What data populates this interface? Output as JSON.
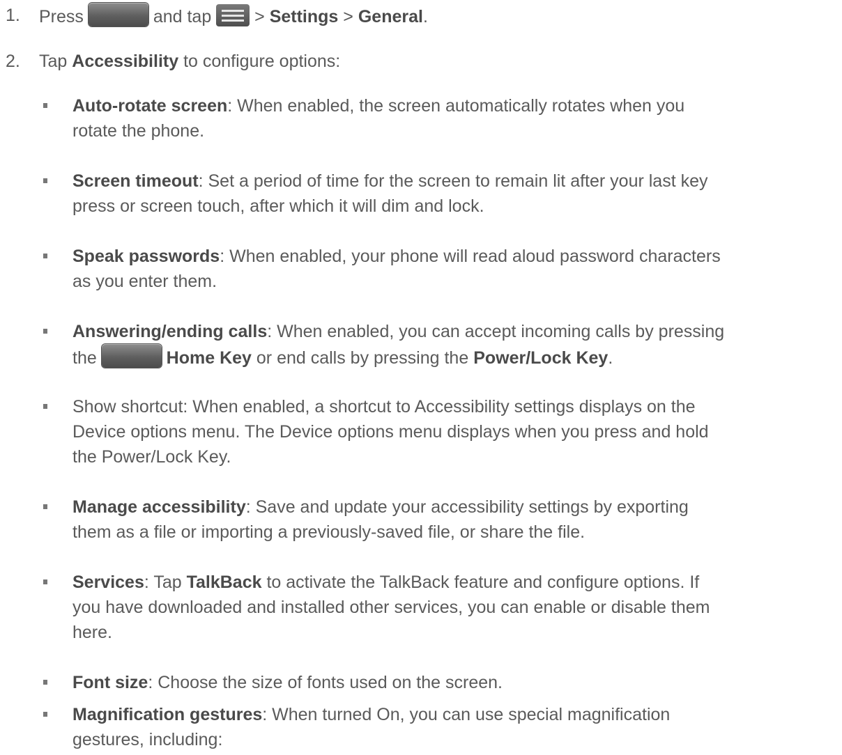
{
  "step1": {
    "number": "1.",
    "press": "Press",
    "and_tap": "and tap",
    "sep1": ">",
    "settings": "Settings",
    "sep2": ">",
    "general": "General",
    "end": ".",
    "home_key_icon": "home-key-icon",
    "menu_icon": "menu-icon"
  },
  "step2": {
    "number": "2.",
    "tap": "Tap",
    "accessibility": "Accessibility",
    "rest": "to configure options:"
  },
  "items": [
    {
      "term": "Auto-rotate screen",
      "text_line1": ": When enabled, the screen automatically rotates when you",
      "text_line2": "rotate the phone."
    },
    {
      "term": "Screen timeout",
      "text_line1": ": Set a period of time for the screen to remain lit after your last key",
      "text_line2": "press or screen touch, after which it will dim and lock."
    },
    {
      "term": "Speak passwords",
      "text_line1": ": When enabled, your phone will read aloud password characters",
      "text_line2": "as you enter them."
    },
    {
      "term": "Answering/ending calls",
      "text_line1": ": When enabled, you can accept incoming calls by pressing",
      "line2_the": "the",
      "home_key": "Home Key",
      "line2_mid": "or end calls by pressing the",
      "power_key": "Power/Lock Key",
      "line2_end": "."
    },
    {
      "text_line1": "Show shortcut: When enabled, a shortcut to Accessibility settings displays on the",
      "text_line2": "Device options menu. The Device options menu displays when you press and hold",
      "text_line3": "the Power/Lock Key."
    },
    {
      "term": "Manage accessibility",
      "text_line1": ": Save and update your accessibility settings by exporting",
      "text_line2": "them as a file or importing a previously-saved file, or share the file."
    },
    {
      "term": "Services",
      "text_a": ": Tap",
      "term2": "TalkBack",
      "text_b": "to activate the TalkBack feature and configure options. If",
      "text_line2": "you have downloaded and installed other services, you can enable or disable them",
      "text_line3": "here."
    },
    {
      "term": "Font size",
      "text_line1": ": Choose the size of fonts used on the screen."
    },
    {
      "term": "Magnification gestures",
      "text_line1": ": When turned On, you can use special magnification",
      "text_line2": "gestures, including:"
    }
  ]
}
